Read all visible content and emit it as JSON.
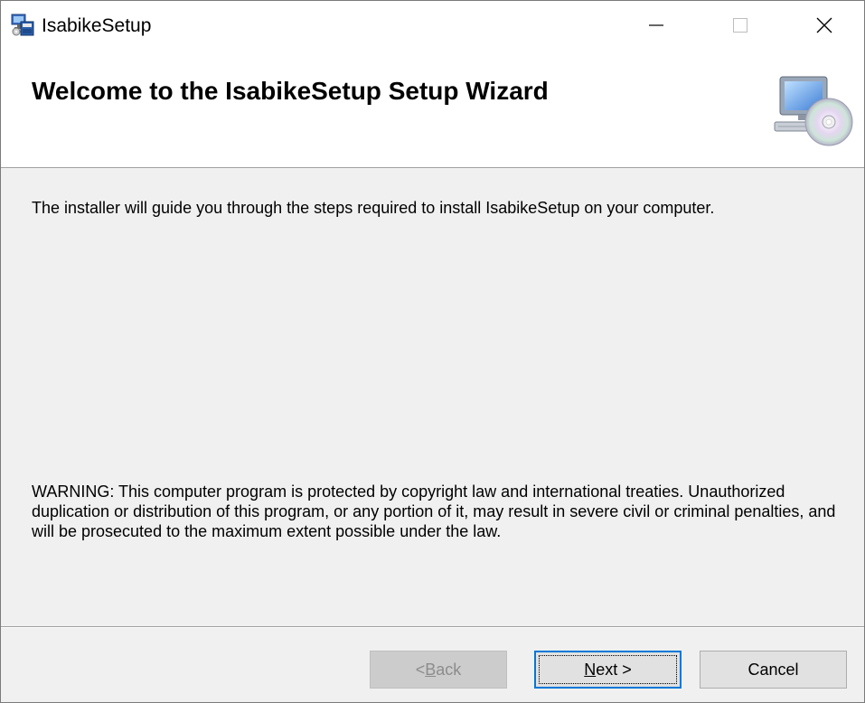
{
  "window": {
    "title": "IsabikeSetup",
    "icon": "installer-app-icon"
  },
  "caption_buttons": {
    "minimize": "minimize-icon",
    "maximize": "maximize-icon",
    "close": "close-icon"
  },
  "header": {
    "title": "Welcome to the IsabikeSetup Setup Wizard",
    "image": "computer-cd-icon"
  },
  "content": {
    "intro": "The installer will guide you through the steps required to install IsabikeSetup on your computer.",
    "warning": "WARNING: This computer program is protected by copyright law and international treaties. Unauthorized duplication or distribution of this program, or any portion of it, may result in severe civil or criminal penalties, and will be prosecuted to the maximum extent possible under the law."
  },
  "buttons": {
    "back_prefix": "< ",
    "back_mnemonic": "B",
    "back_rest": "ack",
    "back_enabled": false,
    "next_mnemonic": "N",
    "next_rest": "ext >",
    "cancel": "Cancel"
  },
  "colors": {
    "focus_border": "#0078d7",
    "window_bg": "#f0f0f0",
    "header_bg": "#ffffff"
  }
}
